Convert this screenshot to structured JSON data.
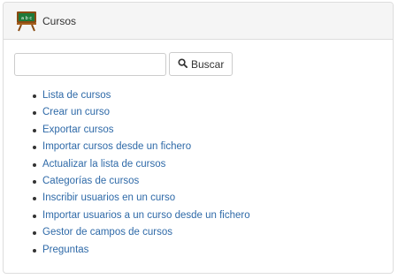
{
  "panel": {
    "title": "Cursos",
    "icon": "blackboard-icon"
  },
  "search": {
    "value": "",
    "placeholder": "",
    "button_label": "Buscar",
    "button_icon": "search-icon"
  },
  "links": [
    {
      "label": "Lista de cursos"
    },
    {
      "label": "Crear un curso"
    },
    {
      "label": "Exportar cursos"
    },
    {
      "label": "Importar cursos desde un fichero"
    },
    {
      "label": "Actualizar la lista de cursos"
    },
    {
      "label": "Categorías de cursos"
    },
    {
      "label": "Inscribir usuarios en un curso"
    },
    {
      "label": "Importar usuarios a un curso desde un fichero"
    },
    {
      "label": "Gestor de campos de cursos"
    },
    {
      "label": "Preguntas"
    }
  ],
  "colors": {
    "link": "#2f6aa8",
    "heading_bg": "#f5f5f5",
    "border": "#dddddd",
    "board_green": "#1f7a3a",
    "easel_wood": "#8a4b12"
  }
}
